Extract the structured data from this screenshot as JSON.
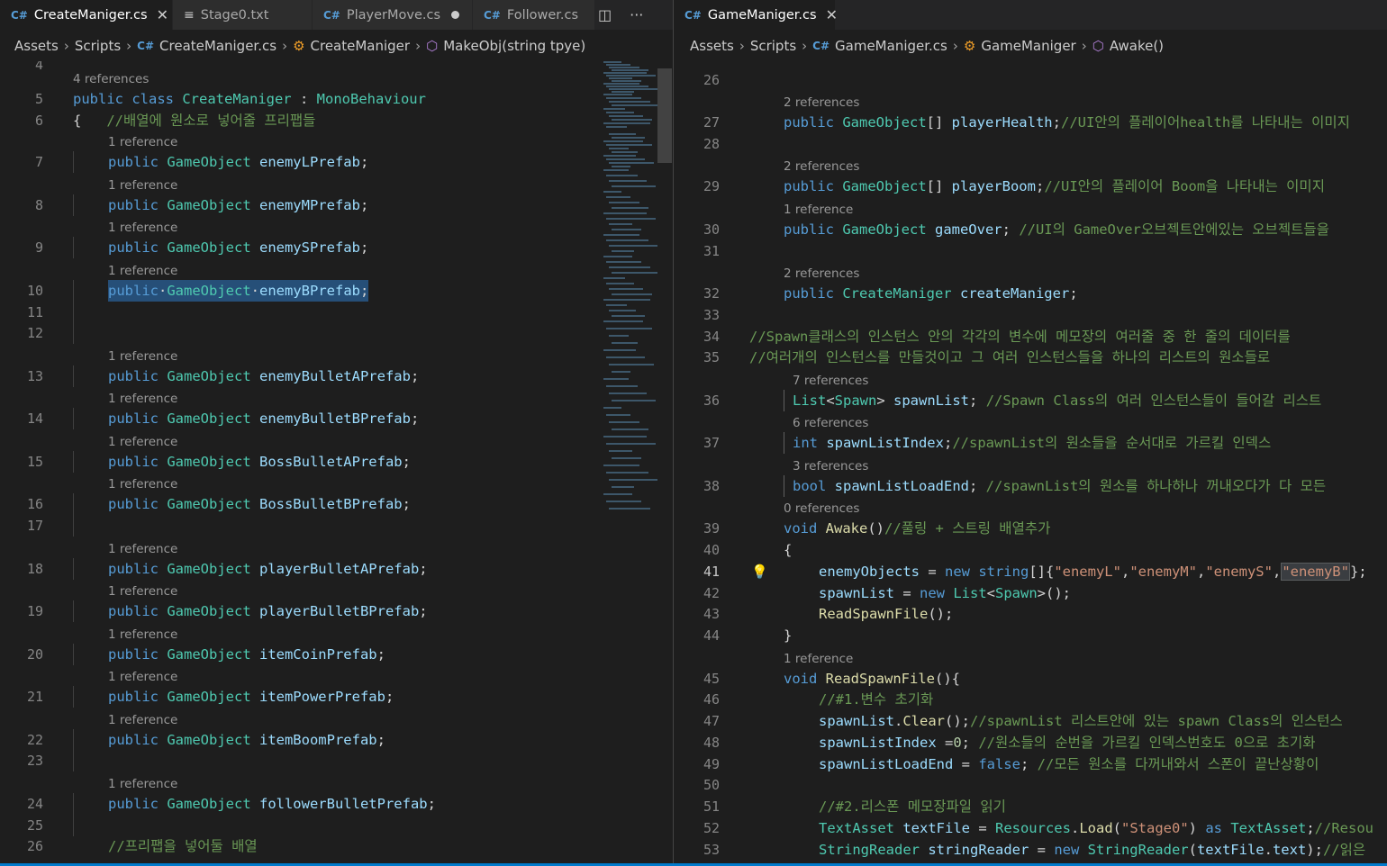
{
  "left_pane": {
    "tabs": [
      {
        "label": "CreateManiger.cs",
        "icon": "csharp-icon",
        "active": true,
        "state": "close"
      },
      {
        "label": "Stage0.txt",
        "icon": "text-file-icon",
        "active": false,
        "state": ""
      },
      {
        "label": "PlayerMove.cs",
        "icon": "csharp-icon",
        "active": false,
        "state": "modified"
      },
      {
        "label": "Follower.cs",
        "icon": "csharp-icon",
        "active": false,
        "state": ""
      }
    ],
    "breadcrumb": {
      "assets": "Assets",
      "scripts": "Scripts",
      "file": "CreateManiger.cs",
      "class": "CreateManiger",
      "method": "MakeObj(string tpye)"
    },
    "lines": [
      {
        "n": "4",
        "lens": ""
      },
      {
        "n": "5",
        "lens": "4 references",
        "tokens": [
          [
            "kw",
            "public "
          ],
          [
            "kw",
            "class "
          ],
          [
            "ty",
            "CreateManiger"
          ],
          [
            "pl",
            " : "
          ],
          [
            "ty",
            "MonoBehaviour"
          ]
        ]
      },
      {
        "n": "6",
        "lens": "",
        "tokens": [
          [
            "pl",
            "{   "
          ],
          [
            "cm",
            "//배열에 원소로 넣어줄 프리팹들"
          ]
        ]
      },
      {
        "n": "7",
        "lens": "1 reference",
        "tokens": [
          [
            "kw",
            "public "
          ],
          [
            "ty",
            "GameObject "
          ],
          [
            "id",
            "enemyLPrefab"
          ],
          [
            "pl",
            ";"
          ]
        ]
      },
      {
        "n": "8",
        "lens": "1 reference",
        "tokens": [
          [
            "kw",
            "public "
          ],
          [
            "ty",
            "GameObject "
          ],
          [
            "id",
            "enemyMPrefab"
          ],
          [
            "pl",
            ";"
          ]
        ]
      },
      {
        "n": "9",
        "lens": "1 reference",
        "tokens": [
          [
            "kw",
            "public "
          ],
          [
            "ty",
            "GameObject "
          ],
          [
            "id",
            "enemySPrefab"
          ],
          [
            "pl",
            ";"
          ]
        ]
      },
      {
        "n": "10",
        "lens": "1 reference",
        "selected": true,
        "tokens": [
          [
            "kw",
            "public"
          ],
          [
            "pl",
            "·"
          ],
          [
            "ty",
            "GameObject"
          ],
          [
            "pl",
            "·"
          ],
          [
            "id",
            "enemyBPrefab"
          ],
          [
            "pl",
            ";"
          ]
        ]
      },
      {
        "n": "11",
        "lens": ""
      },
      {
        "n": "12",
        "lens": ""
      },
      {
        "n": "13",
        "lens": "1 reference",
        "tokens": [
          [
            "kw",
            "public "
          ],
          [
            "ty",
            "GameObject "
          ],
          [
            "id",
            "enemyBulletAPrefab"
          ],
          [
            "pl",
            ";"
          ]
        ]
      },
      {
        "n": "14",
        "lens": "1 reference",
        "tokens": [
          [
            "kw",
            "public "
          ],
          [
            "ty",
            "GameObject "
          ],
          [
            "id",
            "enemyBulletBPrefab"
          ],
          [
            "pl",
            ";"
          ]
        ]
      },
      {
        "n": "15",
        "lens": "1 reference",
        "tokens": [
          [
            "kw",
            "public "
          ],
          [
            "ty",
            "GameObject "
          ],
          [
            "id",
            "BossBulletAPrefab"
          ],
          [
            "pl",
            ";"
          ]
        ]
      },
      {
        "n": "16",
        "lens": "1 reference",
        "tokens": [
          [
            "kw",
            "public "
          ],
          [
            "ty",
            "GameObject "
          ],
          [
            "id",
            "BossBulletBPrefab"
          ],
          [
            "pl",
            ";"
          ]
        ]
      },
      {
        "n": "17",
        "lens": ""
      },
      {
        "n": "18",
        "lens": "1 reference",
        "tokens": [
          [
            "kw",
            "public "
          ],
          [
            "ty",
            "GameObject "
          ],
          [
            "id",
            "playerBulletAPrefab"
          ],
          [
            "pl",
            ";"
          ]
        ]
      },
      {
        "n": "19",
        "lens": "1 reference",
        "tokens": [
          [
            "kw",
            "public "
          ],
          [
            "ty",
            "GameObject "
          ],
          [
            "id",
            "playerBulletBPrefab"
          ],
          [
            "pl",
            ";"
          ]
        ]
      },
      {
        "n": "20",
        "lens": "1 reference",
        "tokens": [
          [
            "kw",
            "public "
          ],
          [
            "ty",
            "GameObject "
          ],
          [
            "id",
            "itemCoinPrefab"
          ],
          [
            "pl",
            ";"
          ]
        ]
      },
      {
        "n": "21",
        "lens": "1 reference",
        "tokens": [
          [
            "kw",
            "public "
          ],
          [
            "ty",
            "GameObject "
          ],
          [
            "id",
            "itemPowerPrefab"
          ],
          [
            "pl",
            ";"
          ]
        ]
      },
      {
        "n": "22",
        "lens": "1 reference",
        "tokens": [
          [
            "kw",
            "public "
          ],
          [
            "ty",
            "GameObject "
          ],
          [
            "id",
            "itemBoomPrefab"
          ],
          [
            "pl",
            ";"
          ]
        ]
      },
      {
        "n": "23",
        "lens": ""
      },
      {
        "n": "24",
        "lens": "1 reference",
        "tokens": [
          [
            "kw",
            "public "
          ],
          [
            "ty",
            "GameObject "
          ],
          [
            "id",
            "followerBulletPrefab"
          ],
          [
            "pl",
            ";"
          ]
        ]
      },
      {
        "n": "25",
        "lens": ""
      },
      {
        "n": "26",
        "lens": "",
        "tokens": [
          [
            "cm",
            "//프리팹을 넣어둘 배열"
          ]
        ]
      }
    ]
  },
  "right_pane": {
    "tabs": [
      {
        "label": "GameManiger.cs",
        "icon": "csharp-icon",
        "active": true,
        "state": "close"
      }
    ],
    "breadcrumb": {
      "assets": "Assets",
      "scripts": "Scripts",
      "file": "GameManiger.cs",
      "class": "GameManiger",
      "method": "Awake()"
    },
    "lines": [
      {
        "n": "26",
        "lens": ""
      },
      {
        "n": "27",
        "lens": "2 references",
        "tokens": [
          [
            "kw",
            "public "
          ],
          [
            "ty",
            "GameObject"
          ],
          [
            "pl",
            "[] "
          ],
          [
            "id",
            "playerHealth"
          ],
          [
            "pl",
            ";"
          ],
          [
            "cm",
            "//UI안의 플레이어health를 나타내는 이미지"
          ]
        ]
      },
      {
        "n": "28",
        "lens": ""
      },
      {
        "n": "29",
        "lens": "2 references",
        "tokens": [
          [
            "kw",
            "public "
          ],
          [
            "ty",
            "GameObject"
          ],
          [
            "pl",
            "[] "
          ],
          [
            "id",
            "playerBoom"
          ],
          [
            "pl",
            ";"
          ],
          [
            "cm",
            "//UI안의 플레이어 Boom을 나타내는 이미지"
          ]
        ]
      },
      {
        "n": "30",
        "lens": "1 reference",
        "tokens": [
          [
            "kw",
            "public "
          ],
          [
            "ty",
            "GameObject "
          ],
          [
            "id",
            "gameOver"
          ],
          [
            "pl",
            "; "
          ],
          [
            "cm",
            "//UI의 GameOver오브젝트안에있는 오브젝트들을"
          ]
        ]
      },
      {
        "n": "31",
        "lens": ""
      },
      {
        "n": "32",
        "lens": "2 references",
        "tokens": [
          [
            "kw",
            "public "
          ],
          [
            "ty",
            "CreateManiger "
          ],
          [
            "id",
            "createManiger"
          ],
          [
            "pl",
            ";"
          ]
        ]
      },
      {
        "n": "33",
        "lens": ""
      },
      {
        "n": "34",
        "lens": "",
        "indent": "none",
        "tokens": [
          [
            "cm",
            "//Spawn클래스의 인스턴스 안의 각각의 변수에 메모장의 여러줄 중 한 줄의 데이터를"
          ]
        ]
      },
      {
        "n": "35",
        "lens": "",
        "indent": "none",
        "tokens": [
          [
            "cm",
            "//여러개의 인스턴스를 만들것이고 그 여러 인스턴스들을 하나의 리스트의 원소들로"
          ]
        ]
      },
      {
        "n": "36",
        "lens": "7 references",
        "indent": "bar",
        "tokens": [
          [
            "ty",
            "List"
          ],
          [
            "pl",
            "<"
          ],
          [
            "ty",
            "Spawn"
          ],
          [
            "pl",
            "> "
          ],
          [
            "id",
            "spawnList"
          ],
          [
            "pl",
            "; "
          ],
          [
            "cm",
            "//Spawn Class의 여러 인스턴스들이 들어갈 리스트"
          ]
        ]
      },
      {
        "n": "37",
        "lens": "6 references",
        "indent": "bar",
        "tokens": [
          [
            "kw",
            "int "
          ],
          [
            "id",
            "spawnListIndex"
          ],
          [
            "pl",
            ";"
          ],
          [
            "cm",
            "//spawnList의 원소들을 순서대로 가르킬 인덱스"
          ]
        ]
      },
      {
        "n": "38",
        "lens": "3 references",
        "indent": "bar",
        "tokens": [
          [
            "kw",
            "bool "
          ],
          [
            "id",
            "spawnListLoadEnd"
          ],
          [
            "pl",
            "; "
          ],
          [
            "cm",
            "//spawnList의 원소를 하나하나 꺼내오다가 다 모든"
          ]
        ]
      },
      {
        "n": "39",
        "lens": "0 references",
        "tokens": [
          [
            "kw",
            "void "
          ],
          [
            "fn",
            "Awake"
          ],
          [
            "pl",
            "()"
          ],
          [
            "cm",
            "//풀링 + 스트링 배열추가"
          ]
        ]
      },
      {
        "n": "40",
        "lens": "",
        "tokens": [
          [
            "pl",
            "{"
          ]
        ]
      },
      {
        "n": "41",
        "lens": "",
        "indent": "deep",
        "current": true,
        "tokens": [
          [
            "id",
            "enemyObjects"
          ],
          [
            "pl",
            " = "
          ],
          [
            "kw",
            "new "
          ],
          [
            "kw",
            "string"
          ],
          [
            "pl",
            "[]{"
          ],
          [
            "st",
            "\"enemyL\""
          ],
          [
            "pl",
            ","
          ],
          [
            "st",
            "\"enemyM\""
          ],
          [
            "pl",
            ","
          ],
          [
            "st",
            "\"enemyS\""
          ],
          [
            "pl",
            ","
          ],
          [
            "st",
            "\"enemyB\""
          ],
          [
            "pl",
            "};"
          ]
        ]
      },
      {
        "n": "42",
        "lens": "",
        "indent": "deep",
        "tokens": [
          [
            "id",
            "spawnList"
          ],
          [
            "pl",
            " = "
          ],
          [
            "kw",
            "new "
          ],
          [
            "ty",
            "List"
          ],
          [
            "pl",
            "<"
          ],
          [
            "ty",
            "Spawn"
          ],
          [
            "pl",
            ">();"
          ]
        ]
      },
      {
        "n": "43",
        "lens": "",
        "indent": "deep",
        "tokens": [
          [
            "fn",
            "ReadSpawnFile"
          ],
          [
            "pl",
            "();"
          ]
        ]
      },
      {
        "n": "44",
        "lens": "",
        "tokens": [
          [
            "pl",
            "}"
          ]
        ]
      },
      {
        "n": "45",
        "lens": "1 reference",
        "tokens": [
          [
            "kw",
            "void "
          ],
          [
            "fn",
            "ReadSpawnFile"
          ],
          [
            "pl",
            "(){"
          ]
        ]
      },
      {
        "n": "46",
        "lens": "",
        "indent": "deep",
        "tokens": [
          [
            "cm",
            "//#1.변수 초기화"
          ]
        ]
      },
      {
        "n": "47",
        "lens": "",
        "indent": "deep",
        "tokens": [
          [
            "id",
            "spawnList"
          ],
          [
            "pl",
            "."
          ],
          [
            "fn",
            "Clear"
          ],
          [
            "pl",
            "();"
          ],
          [
            "cm",
            "//spawnList 리스트안에 있는 spawn Class의 인스턴스"
          ]
        ]
      },
      {
        "n": "48",
        "lens": "",
        "indent": "deep",
        "tokens": [
          [
            "id",
            "spawnListIndex"
          ],
          [
            "pl",
            " ="
          ],
          [
            "nm",
            "0"
          ],
          [
            "pl",
            "; "
          ],
          [
            "cm",
            "//원소들의 순번을 가르킬 인덱스번호도 0으로 초기화"
          ]
        ]
      },
      {
        "n": "49",
        "lens": "",
        "indent": "deep",
        "tokens": [
          [
            "id",
            "spawnListLoadEnd"
          ],
          [
            "pl",
            " = "
          ],
          [
            "kw",
            "false"
          ],
          [
            "pl",
            "; "
          ],
          [
            "cm",
            "//모든 원소를 다꺼내와서 스폰이 끝난상황이"
          ]
        ]
      },
      {
        "n": "50",
        "lens": ""
      },
      {
        "n": "51",
        "lens": "",
        "indent": "deep",
        "tokens": [
          [
            "cm",
            "//#2.리스폰 메모장파일 읽기"
          ]
        ]
      },
      {
        "n": "52",
        "lens": "",
        "indent": "deep",
        "tokens": [
          [
            "ty",
            "TextAsset "
          ],
          [
            "id",
            "textFile"
          ],
          [
            "pl",
            " = "
          ],
          [
            "ty",
            "Resources"
          ],
          [
            "pl",
            "."
          ],
          [
            "fn",
            "Load"
          ],
          [
            "pl",
            "("
          ],
          [
            "st",
            "\"Stage0\""
          ],
          [
            "pl",
            ") "
          ],
          [
            "kw",
            "as "
          ],
          [
            "ty",
            "TextAsset"
          ],
          [
            "pl",
            ";"
          ],
          [
            "cm",
            "//Resou"
          ]
        ]
      },
      {
        "n": "53",
        "lens": "",
        "indent": "deep",
        "tokens": [
          [
            "ty",
            "StringReader "
          ],
          [
            "id",
            "stringReader"
          ],
          [
            "pl",
            " = "
          ],
          [
            "kw",
            "new "
          ],
          [
            "ty",
            "StringReader"
          ],
          [
            "pl",
            "("
          ],
          [
            "id",
            "textFile"
          ],
          [
            "pl",
            "."
          ],
          [
            "id",
            "text"
          ],
          [
            "pl",
            ");"
          ],
          [
            "cm",
            "//읽은"
          ]
        ]
      }
    ]
  },
  "colors": {
    "background": "#1e1e1e",
    "keyword": "#569cd6",
    "type": "#4ec9b0",
    "identifier": "#9cdcfe",
    "function": "#dcdcaa",
    "comment": "#6a9955",
    "string": "#ce9178",
    "selection": "#264f78",
    "statusbar": "#007acc"
  }
}
